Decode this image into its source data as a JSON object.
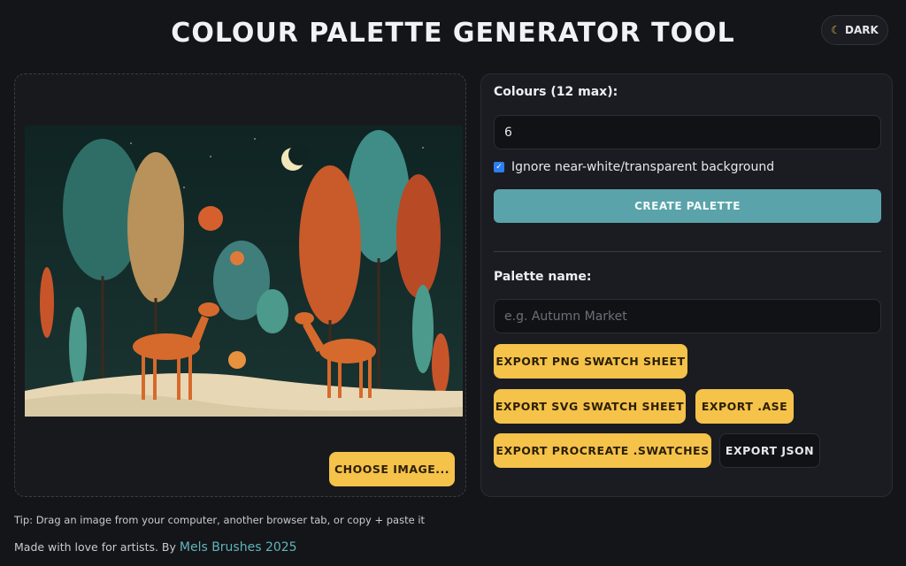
{
  "header": {
    "title": "COLOUR PALETTE GENERATOR TOOL",
    "theme_toggle": {
      "icon": "moon-icon",
      "label": "DARK"
    }
  },
  "image_panel": {
    "image_description_icon": "image-preview",
    "choose_button": "CHOOSE IMAGE..."
  },
  "controls": {
    "colours_label": "Colours (12 max):",
    "colours_value": "6",
    "ignore_background": {
      "checked": true,
      "label": "Ignore near-white/transparent background"
    },
    "create_button": "CREATE PALETTE",
    "palette_name_label": "Palette name:",
    "palette_name_placeholder": "e.g. Autumn Market",
    "palette_name_value": ""
  },
  "exports": {
    "png": "EXPORT PNG SWATCH SHEET",
    "svg": "EXPORT SVG SWATCH SHEET",
    "ase": "EXPORT .ASE",
    "procreate": "EXPORT PROCREATE .SWATCHES",
    "json": "EXPORT JSON"
  },
  "tip": "Tip: Drag an image from your computer, another browser tab, or copy + paste it",
  "footer": {
    "text": "Made with love for artists. By ",
    "link": "Mels Brushes 2025"
  },
  "colors": {
    "accent_yellow": "#f5c24a",
    "accent_teal": "#5aa3aa",
    "background": "#141519",
    "link": "#5fb5bb"
  }
}
